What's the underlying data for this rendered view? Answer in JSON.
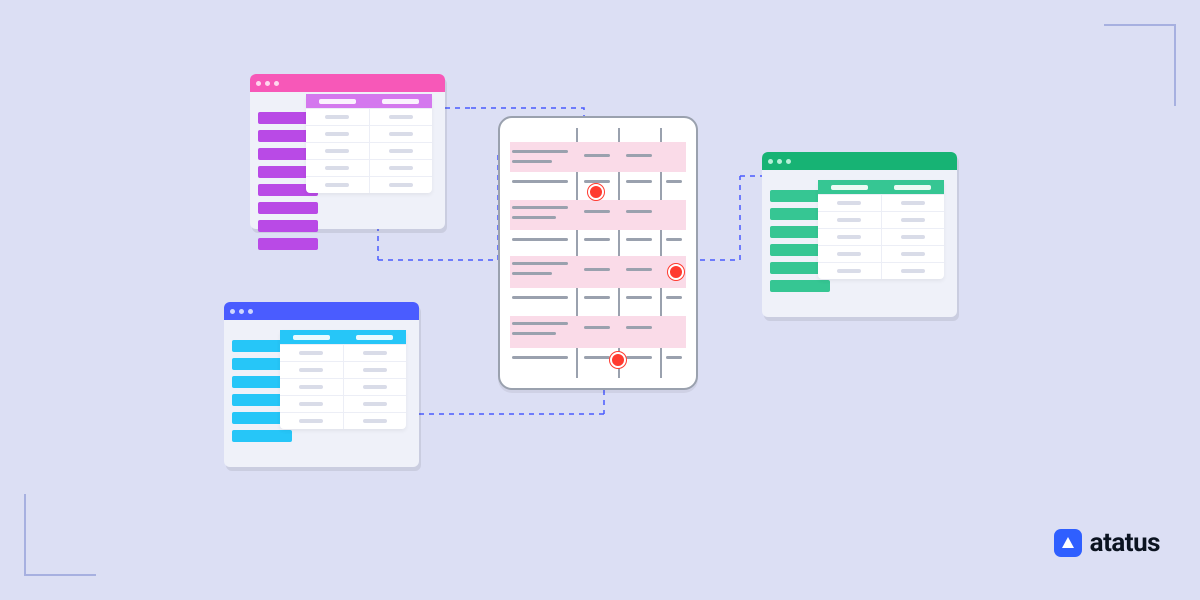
{
  "brand": {
    "name": "atatus",
    "accent": "#2f5fff"
  },
  "diagram": {
    "description": "A central document with highlighted rows and three issue markers, each linked by dashed connector arrows to a color-coded mini report window.",
    "center": {
      "type": "document-grid",
      "columns": 4,
      "highlighted_rows": 4,
      "issue_markers": 3,
      "issue_color": "#ff3b30"
    },
    "reports": [
      {
        "id": "pink",
        "position": "top-left",
        "accent": "#f758b8",
        "columns": 2,
        "rows": 5,
        "sidebar_bars": 8
      },
      {
        "id": "blue",
        "position": "bottom-left",
        "accent": "#4a5cff",
        "columns": 2,
        "rows": 5,
        "sidebar_bars": 6
      },
      {
        "id": "green",
        "position": "right",
        "accent": "#17b374",
        "columns": 2,
        "rows": 5,
        "sidebar_bars": 6
      }
    ],
    "connectors": [
      {
        "from": "center.issue1",
        "to": "pink"
      },
      {
        "from": "center.issue2",
        "to": "green"
      },
      {
        "from": "center.issue3",
        "to": "blue"
      }
    ]
  }
}
